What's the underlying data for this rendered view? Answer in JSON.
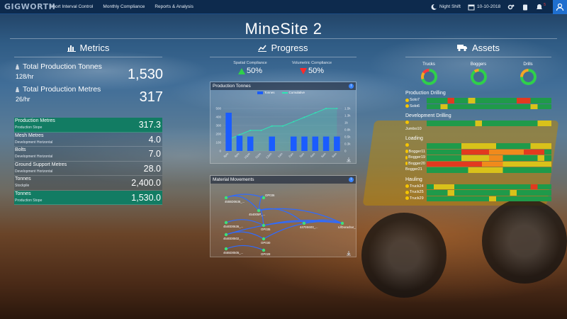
{
  "topbar": {
    "logo": "GIGWORTH",
    "nav": [
      "Short Interval Control",
      "Monthly Compliance",
      "Reports & Analysis"
    ],
    "shift": "Night Shift",
    "date": "10-10-2018",
    "alert_count": "5"
  },
  "site_title": "MineSite 2",
  "sections": {
    "metrics": "Metrics",
    "progress": "Progress",
    "assets": "Assets"
  },
  "metrics": {
    "production_tonnes": {
      "label": "Total Production Tonnes",
      "rate": "128/hr",
      "value": "1,530"
    },
    "production_metres": {
      "label": "Total Production Metres",
      "rate": "26/hr",
      "value": "317"
    },
    "kpis": [
      {
        "name": "Production Metres",
        "sub": "Production Stope",
        "value": "317.3",
        "highlight": true
      },
      {
        "name": "Mesh Metres",
        "sub": "Development Horizontal",
        "value": "4.0",
        "highlight": false
      },
      {
        "name": "Bolts",
        "sub": "Development Horizontal",
        "value": "7.0",
        "highlight": false
      },
      {
        "name": "Ground Support Metres",
        "sub": "Development Horizontal",
        "value": "28.0",
        "highlight": false
      },
      {
        "name": "Tonnes",
        "sub": "Stockpile",
        "value": "2,400.0",
        "highlight": false
      },
      {
        "name": "Tonnes",
        "sub": "Production Stope",
        "value": "1,530.0",
        "highlight": true
      }
    ]
  },
  "progress": {
    "spatial": {
      "label": "Spatial Compliance",
      "value": "50%"
    },
    "volumetric": {
      "label": "Volumetric Compliance",
      "value": "50%"
    }
  },
  "production_panel": {
    "title": "Production Tonnes",
    "legend_tonnes": "Tonnes",
    "legend_cumulative": "Cumulative"
  },
  "material_panel": {
    "title": "Material Movements",
    "nodes": [
      "4555D0636_...",
      "OP036",
      "454005P_...",
      "4540D0636_...",
      "OP035",
      "4470S603_...",
      "LifDorachar_D",
      "4540D0502_...",
      "OP030",
      "4555D0505_...",
      "OP028"
    ]
  },
  "colors": {
    "topbar": "#0d2a4d",
    "accent": "#127c63",
    "up": "#2fd04a",
    "down": "#ff2a2a",
    "tonnes_bar": "#1a5cff",
    "cumulative": "#2ee6b5"
  },
  "chart_data": {
    "type": "bar",
    "title": "Production Tonnes",
    "categories": [
      "8pm",
      "9pm",
      "10pm",
      "11pm",
      "12am",
      "1am",
      "2am",
      "3am",
      "4am",
      "5am",
      "6am"
    ],
    "series": [
      {
        "name": "Tonnes",
        "type": "bar",
        "values": [
          450,
          180,
          170,
          0,
          170,
          0,
          170,
          170,
          170,
          170,
          170
        ]
      },
      {
        "name": "Cumulative",
        "type": "area",
        "values": [
          450,
          630,
          800,
          800,
          970,
          970,
          1140,
          1310,
          1480,
          1650,
          1650
        ]
      }
    ],
    "y_left_ticks": [
      "0",
      "100",
      "200",
      "300",
      "400",
      "500"
    ],
    "y_right_ticks": [
      "0",
      "0.3k",
      "0.5k",
      "0.8k",
      "1k",
      "1.3k",
      "1.5k"
    ],
    "ylim_left": [
      0,
      500
    ],
    "ylim_right": [
      0,
      1650
    ],
    "legend": "top"
  },
  "assets": {
    "gauges": [
      {
        "label": "Trucks",
        "green": 0.7,
        "orange": 0.15,
        "red": 0.15
      },
      {
        "label": "Boggers",
        "green": 0.9,
        "orange": 0.1,
        "red": 0
      },
      {
        "label": "Drills",
        "green": 0.75,
        "orange": 0.25,
        "red": 0
      }
    ],
    "groups": [
      {
        "title": "Production Drilling",
        "rows": [
          {
            "name": "Solo7",
            "icon": "warn",
            "pattern": "gggrggyggggggrrggg"
          },
          {
            "name": "Solo6",
            "icon": "warn",
            "pattern": "ggyggggggggggggygg"
          }
        ]
      },
      {
        "title": "Development Drilling",
        "rows": [
          {
            "name": "",
            "icon": "warn",
            "pattern": "gggggggyggggggggyy"
          },
          {
            "name": "Jumbo10",
            "icon": "none",
            "pattern": ""
          }
        ]
      },
      {
        "title": "Loading",
        "rows": [
          {
            "name": "",
            "icon": "warn",
            "pattern": "gggggyyyyygggggyyy"
          },
          {
            "name": "Bogger11",
            "icon": "hand",
            "pattern": "gggggrrrrooooorrrg"
          },
          {
            "name": "Bogger19",
            "icon": "hand",
            "pattern": "gggggyyyyoogggggyg"
          },
          {
            "name": "Bogger20",
            "icon": "warn",
            "pattern": "rrrrrrrroooyyyyyyy"
          },
          {
            "name": "Bogger21",
            "icon": "none",
            "pattern": "ggggggyyyyyggggggg"
          }
        ]
      },
      {
        "title": "Hauling",
        "rows": [
          {
            "name": "Truck24",
            "icon": "hand",
            "pattern": "gyyygggggggggggrgg"
          },
          {
            "name": "Truck25",
            "icon": "hand",
            "pattern": "gggyggggggggyggggg"
          },
          {
            "name": "Truck29",
            "icon": "hand",
            "pattern": "gggggggggygggggggg"
          }
        ]
      }
    ]
  }
}
